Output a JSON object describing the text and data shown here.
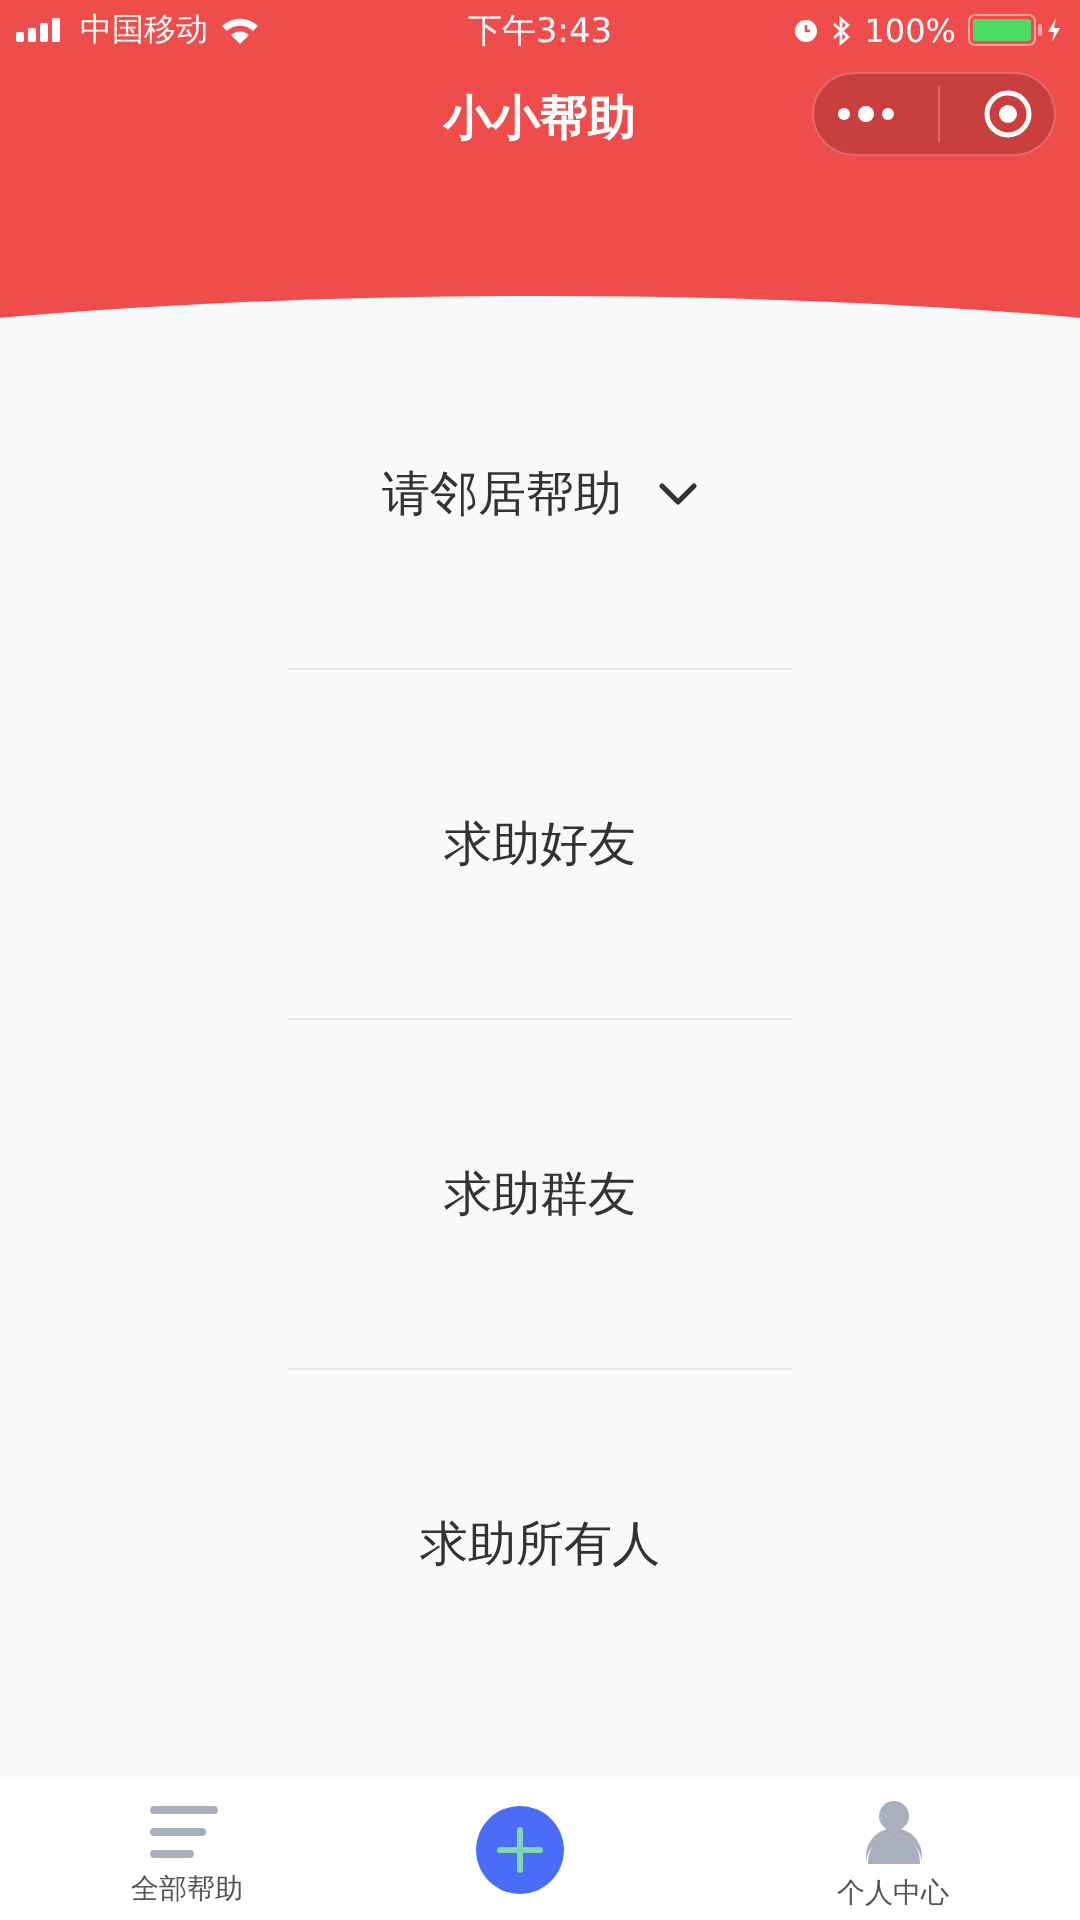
{
  "status_bar": {
    "carrier": "中国移动",
    "time": "下午3:43",
    "battery": "100%"
  },
  "nav": {
    "title": "小小帮助"
  },
  "options": [
    {
      "label": "请邻居帮助",
      "kind": "dropdown"
    },
    {
      "label": "求助好友",
      "kind": "plain"
    },
    {
      "label": "求助群友",
      "kind": "plain"
    },
    {
      "label": "求助所有人",
      "kind": "plain"
    }
  ],
  "tab_bar": [
    {
      "kind": "list",
      "label": "全部帮助"
    },
    {
      "kind": "add"
    },
    {
      "kind": "person",
      "label": "个人中心"
    }
  ]
}
